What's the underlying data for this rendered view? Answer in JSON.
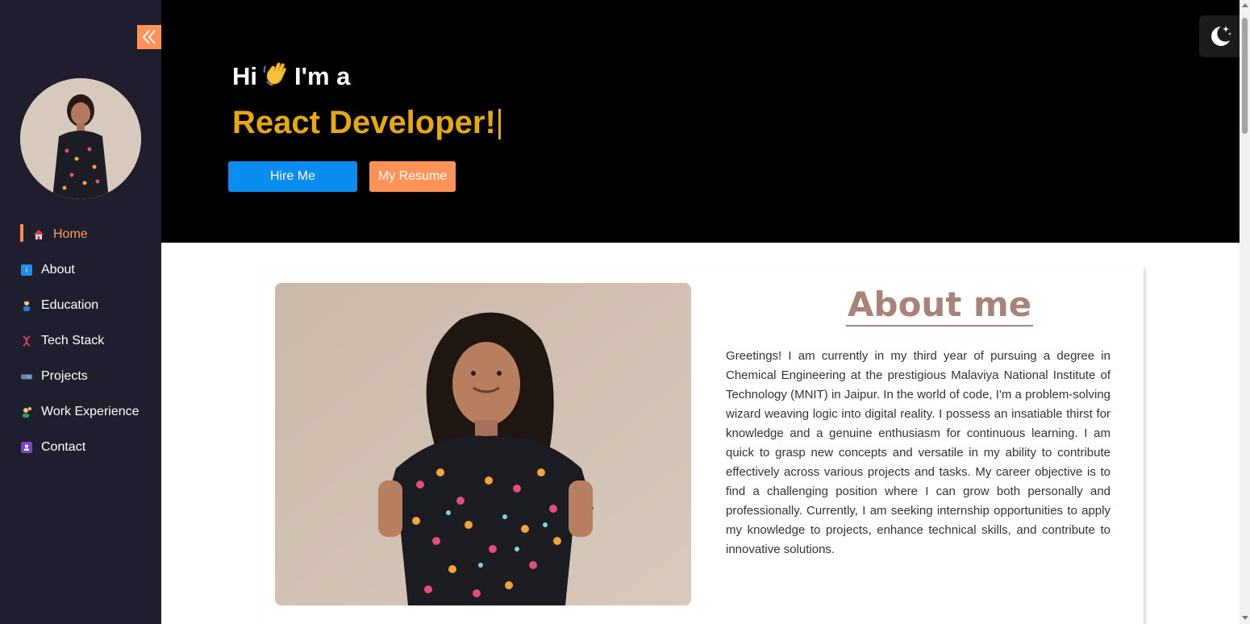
{
  "sidebar": {
    "collapse_icon": "double-chevron-left-icon",
    "nav": [
      {
        "label": "Home",
        "icon": "house-icon",
        "active": true
      },
      {
        "label": "About",
        "icon": "info-icon",
        "active": false
      },
      {
        "label": "Education",
        "icon": "student-icon",
        "active": false
      },
      {
        "label": "Tech Stack",
        "icon": "dna-icon",
        "active": false
      },
      {
        "label": "Projects",
        "icon": "projector-icon",
        "active": false
      },
      {
        "label": "Work Experience",
        "icon": "worker-icon",
        "active": false
      },
      {
        "label": "Contact",
        "icon": "contact-card-icon",
        "active": false
      }
    ]
  },
  "hero": {
    "greeting_hi": "Hi",
    "greeting_rest": "I'm a",
    "role": "React Developer!",
    "hire_label": "Hire Me",
    "resume_label": "My Resume"
  },
  "theme_toggle": {
    "icon": "moon-stars-icon"
  },
  "about": {
    "title": "About me",
    "text": "Greetings! I am currently in my third year of pursuing a degree in Chemical Engineering at the prestigious Malaviya National Institute of Technology (MNIT) in Jaipur. In the world of code, I'm a problem-solving wizard weaving logic into digital reality. I possess an insatiable thirst for knowledge and a genuine enthusiasm for continuous learning. I am quick to grasp new concepts and versatile in my ability to contribute effectively across various projects and tasks. My career objective is to find a challenging position where I can grow both personally and professionally. Currently, I am seeking internship opportunities to apply my knowledge to projects, enhance technical skills, and contribute to innovative solutions."
  },
  "colors": {
    "sidebar_bg": "#1e1e2f",
    "accent_orange": "#ff9257",
    "hero_bg": "#000000",
    "role_gold": "#e8a80f",
    "hire_blue": "#0a8cf0",
    "about_title": "#a88478"
  }
}
